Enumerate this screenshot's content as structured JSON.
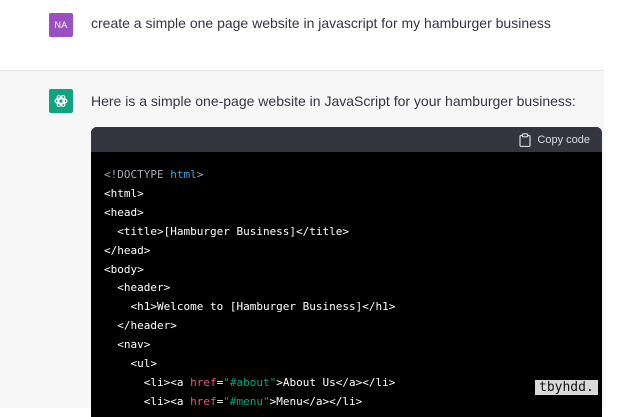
{
  "user": {
    "avatar": "NA",
    "avatar_color": "#9b4fc4",
    "message": "create a simple one page website in javascript for my hamburger business"
  },
  "assistant": {
    "avatar_icon": "openai-logo-icon",
    "avatar_color": "#10a37f",
    "message": "Here is a simple one-page website in JavaScript for your hamburger business:"
  },
  "code_block": {
    "copy_icon": "clipboard-icon",
    "copy_label": "Copy code",
    "lines": {
      "l1a": "<!DOCTYPE ",
      "l1b": "html",
      "l1c": ">",
      "l2": "<html>",
      "l3": "<head>",
      "l4": "  <title>[Hamburger Business]</title>",
      "l5": "</head>",
      "l6": "<body>",
      "l7": "  <header>",
      "l8": "    <h1>Welcome to [Hamburger Business]</h1>",
      "l9": "  </header>",
      "l10": "  <nav>",
      "l11": "    <ul>",
      "l12a": "      <li><a ",
      "l12b": "href",
      "l12c": "=",
      "l12d": "\"#about\"",
      "l12e": ">About Us</a></li>",
      "l13a": "      <li><a ",
      "l13b": "href",
      "l13c": "=",
      "l13d": "\"#menu\"",
      "l13e": ">Menu</a></li>"
    }
  },
  "watermark": "tbyhdd."
}
